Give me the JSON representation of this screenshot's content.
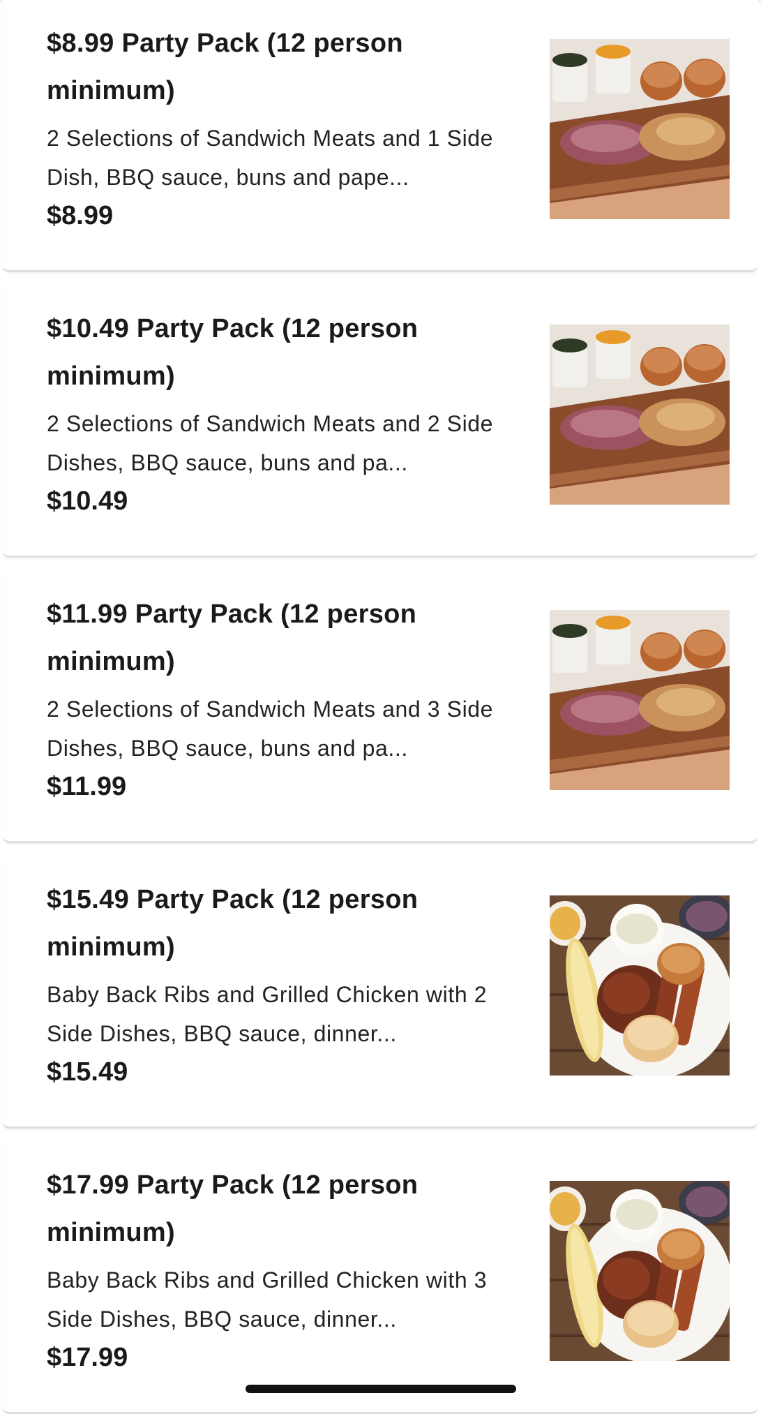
{
  "menu": {
    "items": [
      {
        "name": "$8.99 Party Pack (12 person minimum)",
        "description": "2 Selections of Sandwich Meats and 1 Side Dish, BBQ sauce, buns and pape...",
        "price": "$8.99",
        "image": "pulled-pork-board-photo"
      },
      {
        "name": "$10.49 Party Pack (12 person minimum)",
        "description": "2 Selections of Sandwich Meats and 2 Side Dishes, BBQ sauce, buns and pa...",
        "price": "$10.49",
        "image": "pulled-pork-board-photo"
      },
      {
        "name": "$11.99 Party Pack (12 person minimum)",
        "description": "2 Selections of Sandwich Meats and 3 Side Dishes, BBQ sauce, buns and pa...",
        "price": "$11.99",
        "image": "pulled-pork-board-photo"
      },
      {
        "name": "$15.49 Party Pack (12 person minimum)",
        "description": "Baby Back Ribs and Grilled Chicken with 2 Side Dishes, BBQ sauce, dinner...",
        "price": "$15.49",
        "image": "ribs-chicken-platter-photo"
      },
      {
        "name": "$17.99 Party Pack (12 person minimum)",
        "description": "Baby Back Ribs and Grilled Chicken with 3 Side Dishes, BBQ sauce, dinner...",
        "price": "$17.99",
        "image": "ribs-chicken-platter-photo"
      }
    ]
  }
}
